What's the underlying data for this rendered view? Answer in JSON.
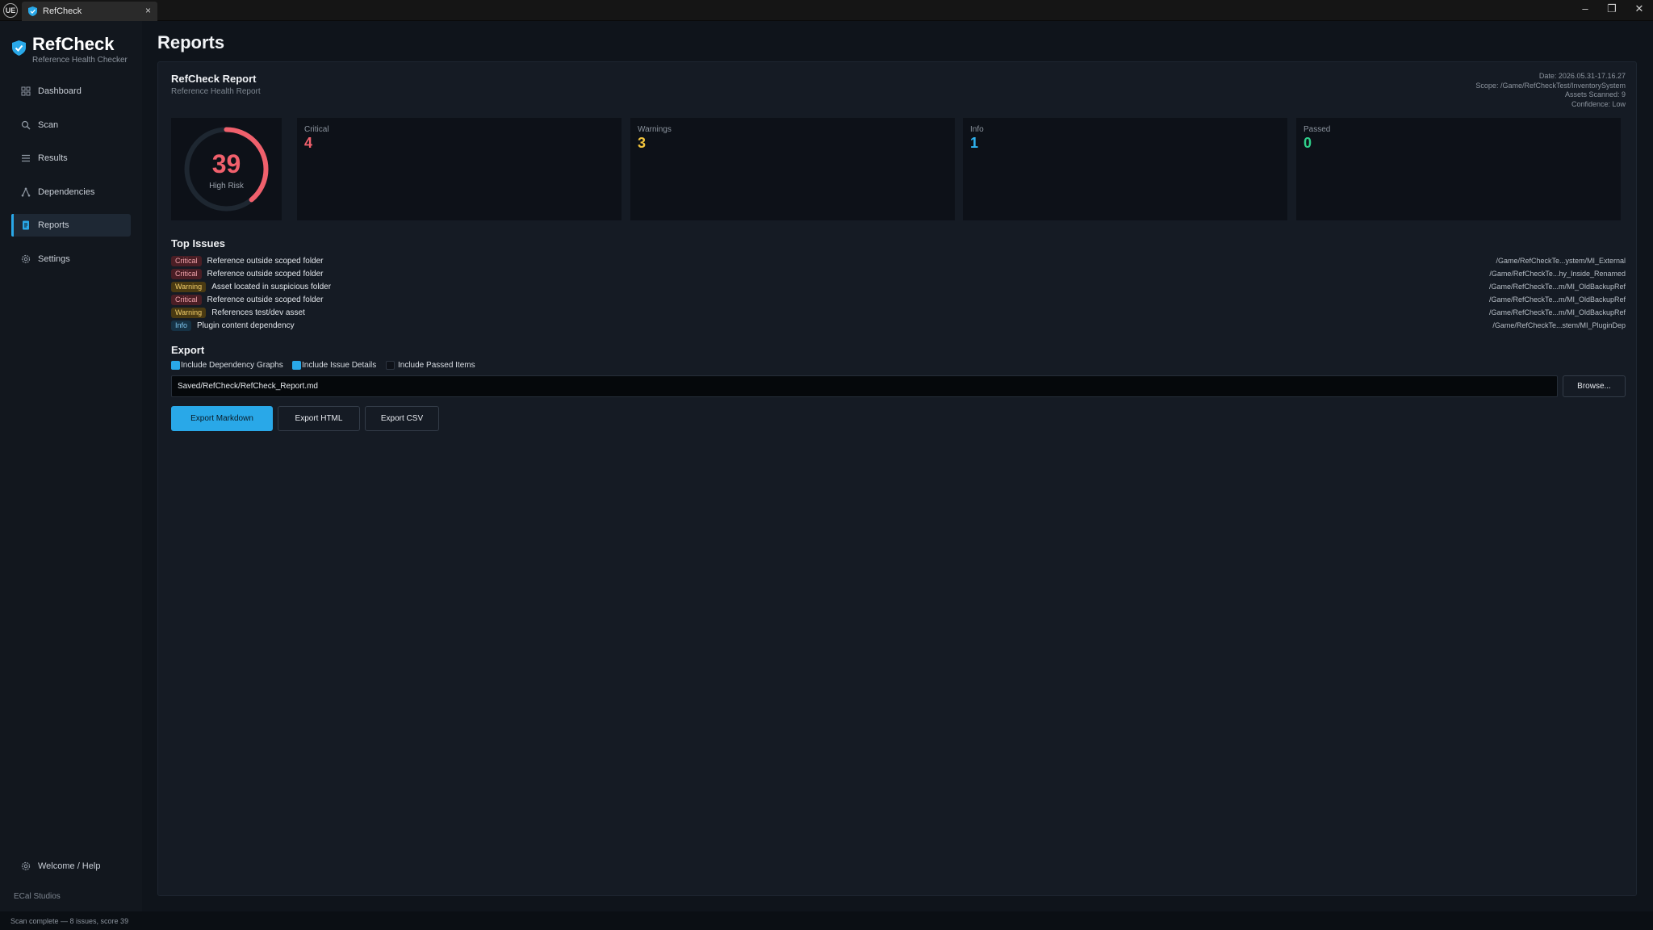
{
  "window": {
    "engine_logo": "UE",
    "tab_title": "RefCheck",
    "tab_close": "×",
    "minimize": "–",
    "restore": "❐",
    "close": "✕"
  },
  "brand": {
    "title": "RefCheck",
    "subtitle": "Reference Health Checker",
    "accent_color": "#29a8e8"
  },
  "sidebar": {
    "items": [
      {
        "label": "Dashboard",
        "icon": "grid-icon"
      },
      {
        "label": "Scan",
        "icon": "search-icon"
      },
      {
        "label": "Results",
        "icon": "list-icon"
      },
      {
        "label": "Dependencies",
        "icon": "graph-icon"
      },
      {
        "label": "Reports",
        "icon": "document-icon",
        "active": true
      },
      {
        "label": "Settings",
        "icon": "gear-icon"
      }
    ],
    "help_label": "Welcome / Help",
    "studio": "ECal Studios"
  },
  "page": {
    "title": "Reports"
  },
  "report": {
    "title": "RefCheck Report",
    "subtitle": "Reference Health Report",
    "meta": {
      "date": "Date: 2026.05.31-17.16.27",
      "scope": "Scope: /Game/RefCheckTest/InventorySystem",
      "assets": "Assets Scanned: 9",
      "confidence": "Confidence: Low"
    }
  },
  "score": {
    "value": "39",
    "label": "High Risk",
    "fraction": 0.39,
    "color": "#f0606c"
  },
  "stats": [
    {
      "label": "Critical",
      "value": "4",
      "color": "#f0606c"
    },
    {
      "label": "Warnings",
      "value": "3",
      "color": "#f2c43d"
    },
    {
      "label": "Info",
      "value": "1",
      "color": "#2fb3f0"
    },
    {
      "label": "Passed",
      "value": "0",
      "color": "#2fcf8a"
    }
  ],
  "top_issues": {
    "title": "Top Issues",
    "items": [
      {
        "severity": "Critical",
        "text": "Reference outside scoped folder",
        "path": "/Game/RefCheckTe...ystem/MI_External"
      },
      {
        "severity": "Critical",
        "text": "Reference outside scoped folder",
        "path": "/Game/RefCheckTe...hy_Inside_Renamed"
      },
      {
        "severity": "Warning",
        "text": "Asset located in suspicious folder",
        "path": "/Game/RefCheckTe...m/MI_OldBackupRef"
      },
      {
        "severity": "Critical",
        "text": "Reference outside scoped folder",
        "path": "/Game/RefCheckTe...m/MI_OldBackupRef"
      },
      {
        "severity": "Warning",
        "text": "References test/dev asset",
        "path": "/Game/RefCheckTe...m/MI_OldBackupRef"
      },
      {
        "severity": "Info",
        "text": "Plugin content dependency",
        "path": "/Game/RefCheckTe...stem/MI_PluginDep"
      }
    ]
  },
  "export": {
    "title": "Export",
    "options": [
      {
        "label": "Include Dependency Graphs",
        "checked": true
      },
      {
        "label": "Include Issue Details",
        "checked": true
      },
      {
        "label": "Include Passed Items",
        "checked": false
      }
    ],
    "path_value": "Saved/RefCheck/RefCheck_Report.md",
    "browse_label": "Browse...",
    "buttons": {
      "markdown": "Export Markdown",
      "html": "Export HTML",
      "csv": "Export CSV"
    }
  },
  "status": {
    "text": "Scan complete — 8 issues, score 39"
  }
}
